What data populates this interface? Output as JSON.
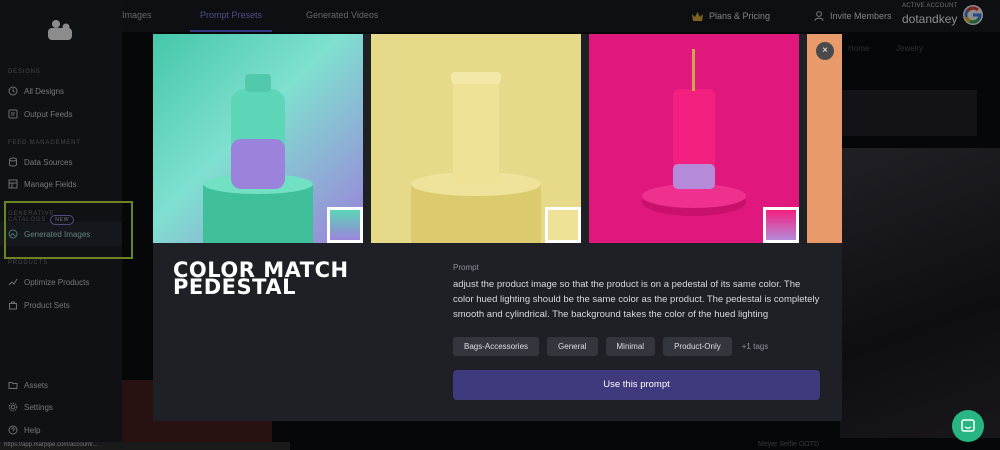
{
  "topbar": {
    "tabs": [
      {
        "label": "Images"
      },
      {
        "label": "Prompt Presets"
      },
      {
        "label": "Generated Videos"
      }
    ],
    "plans_label": "Plans & Pricing",
    "invite_label": "Invite Members",
    "account_label": "ACTIVE ACCOUNT",
    "account_name": "dotandkey"
  },
  "sidebar": {
    "sections": [
      {
        "label": "DESIGNS"
      },
      {
        "label": "FEED MANAGEMENT"
      },
      {
        "label": "GENERATIVE CATALOGS",
        "badge": "NEW"
      },
      {
        "label": "PRODUCTS"
      }
    ],
    "items": [
      {
        "label": "All Designs",
        "icon": "history-icon"
      },
      {
        "label": "Output Feeds",
        "icon": "feed-icon"
      },
      {
        "label": "Data Sources",
        "icon": "database-icon"
      },
      {
        "label": "Manage Fields",
        "icon": "fields-icon"
      },
      {
        "label": "Generated Images",
        "icon": "image-gen-icon"
      },
      {
        "label": "Optimize Products",
        "icon": "chart-icon"
      },
      {
        "label": "Product Sets",
        "icon": "bag-icon"
      },
      {
        "label": "Assets",
        "icon": "folder-icon"
      },
      {
        "label": "Settings",
        "icon": "gear-icon"
      },
      {
        "label": "Help",
        "icon": "help-icon"
      }
    ]
  },
  "background": {
    "labels": [
      "Home",
      "Jewelry"
    ],
    "caption": "Meyer Selfie OOTD"
  },
  "modal": {
    "title": "COLOR MATCH PEDESTAL",
    "prompt_label": "Prompt",
    "prompt_text": "adjust the product image so that the product is on a pedestal of its same color. The color hued lighting should be the same color as the product. The pedestal is completely smooth and cylindrical. The background takes the color of the hued lighting",
    "tags": [
      "Bags-Accessories",
      "General",
      "Minimal",
      "Product-Only"
    ],
    "more_tags": "+1 tags",
    "cta_label": "Use this prompt",
    "close_label": "×",
    "colors": {
      "panel1": "#5fd0b4",
      "panel2": "#e6d98a",
      "panel3": "#e0187e",
      "panel4": "#e99a6b",
      "cta": "#3f3a7d"
    }
  },
  "status_url": "https://app.marpipe.com/account/..."
}
